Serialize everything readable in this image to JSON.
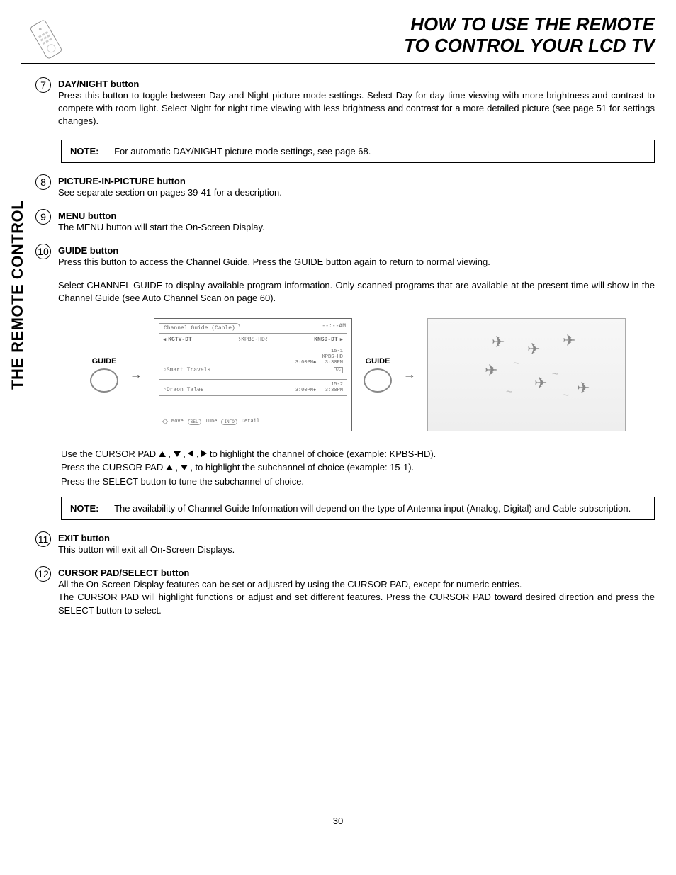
{
  "header": {
    "title_line1": "HOW TO USE THE REMOTE",
    "title_line2": "TO CONTROL YOUR LCD TV"
  },
  "side_tab": "THE REMOTE CONTROL",
  "sections": [
    {
      "num": "7",
      "heading": "DAY/NIGHT button",
      "text": "Press this button to toggle between Day and Night picture mode settings.  Select Day for day time viewing with more brightness and contrast to compete with room light.  Select Night for night time viewing with less brightness and contrast for a more detailed picture (see page 51 for settings changes)."
    },
    {
      "num": "8",
      "heading": "PICTURE-IN-PICTURE button",
      "text": "See separate section on pages 39-41 for a description."
    },
    {
      "num": "9",
      "heading": "MENU button",
      "text": "The MENU button will start the On-Screen Display."
    },
    {
      "num": "10",
      "heading": "GUIDE button",
      "text": "Press this button to access the Channel Guide.  Press the GUIDE button again to return to normal viewing.",
      "text2": "Select CHANNEL GUIDE to display available program information.  Only scanned programs that are available at the present time will show in the Channel Guide (see Auto Channel Scan on page 60)."
    },
    {
      "num": "11",
      "heading": "EXIT button",
      "text": "This button will exit all On-Screen Displays."
    },
    {
      "num": "12",
      "heading": "CURSOR PAD/SELECT button",
      "text": "All the On-Screen Display features can be set or adjusted by using the CURSOR PAD, except for numeric entries.",
      "text2": "The CURSOR PAD will highlight functions or adjust and set different features.  Press the CURSOR PAD toward desired direction and press the SELECT button to select."
    }
  ],
  "notes": {
    "label": "NOTE:",
    "note1": "For automatic DAY/NIGHT picture mode settings, see page 68.",
    "note2": "The availability of Channel Guide Information will depend on the type of Antenna input (Analog, Digital) and Cable subscription."
  },
  "guide_label": "GUIDE",
  "channel_guide": {
    "tab": "Channel Guide (Cable)",
    "time": "--:--AM",
    "ch_left": "KGTV-DT",
    "ch_mid": "KPBS-HD",
    "ch_right": "KNSD-DT",
    "programs": [
      {
        "title": "Smart Travels",
        "sub": "15-1",
        "ch": "KPBS-HD",
        "start": "3:00PM",
        "end": "3:30PM",
        "cc": true
      },
      {
        "title": "Draon Tales",
        "sub": "15-2",
        "ch": "",
        "start": "3:00PM",
        "end": "3:30PM",
        "cc": false
      }
    ],
    "footer": {
      "move": "Move",
      "tune": "Tune",
      "detail": "Detail",
      "sel": "SEL",
      "info": "INFO"
    }
  },
  "cursor_instructions": {
    "line1_a": "Use the CURSOR PAD ",
    "line1_b": " to highlight the channel of choice (example: KPBS-HD).",
    "line2_a": "Press  the CURSOR PAD ",
    "line2_b": " , to highlight the subchannel of choice (example: 15-1).",
    "line3": "Press the SELECT button to tune the subchannel of choice."
  },
  "page_number": "30"
}
